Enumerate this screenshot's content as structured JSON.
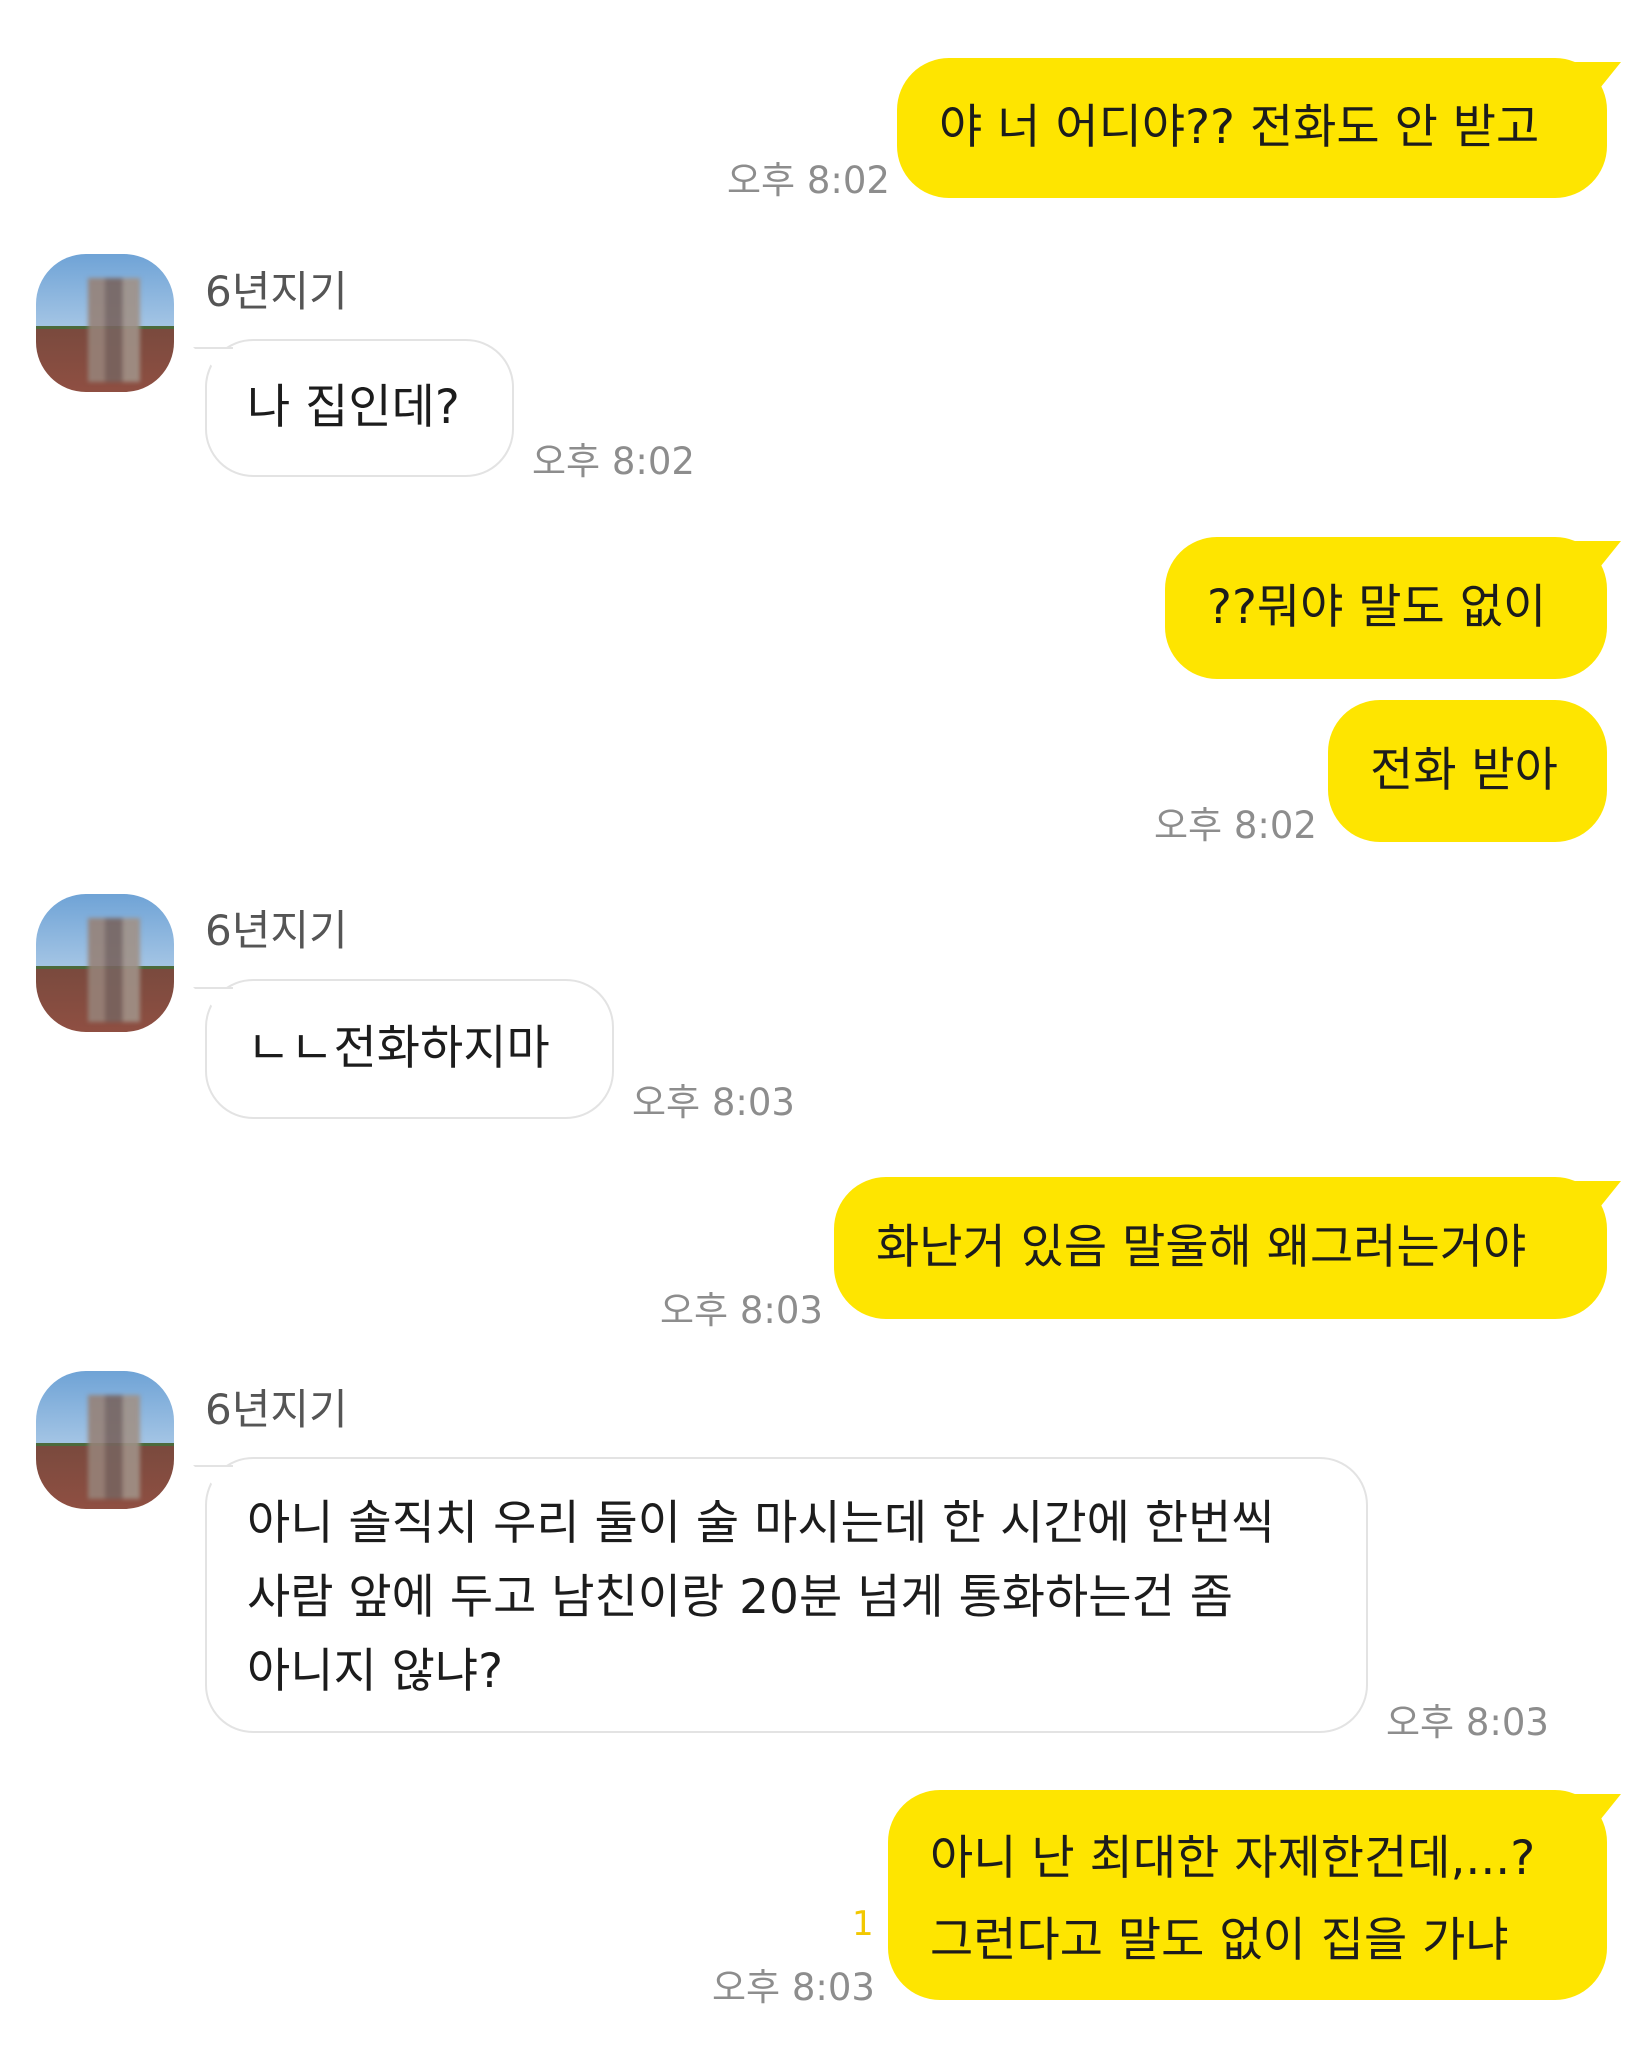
{
  "contact_name": "6년지기",
  "messages": [
    {
      "from": "me",
      "text": "야 너 어디야?? 전화도 안 받고",
      "time": "오후 8:02"
    },
    {
      "from": "them",
      "text": "나 집인데?",
      "time": "오후 8:02"
    },
    {
      "from": "me",
      "text": "??뭐야 말도 없이",
      "time": ""
    },
    {
      "from": "me",
      "text": "전화 받아",
      "time": "오후 8:02"
    },
    {
      "from": "them",
      "text": "ㄴㄴ전화하지마",
      "time": "오후 8:03"
    },
    {
      "from": "me",
      "text": "화난거 있음 말울해 왜그러는거야",
      "time": "오후 8:03"
    },
    {
      "from": "them",
      "lines": [
        "아니 솔직치 우리 둘이 술 마시는데 한 시간에 한번씩",
        "사람 앞에 두고 남친이랑 20분 넘게 통화하는건 좀",
        "아니지 않냐?"
      ],
      "time": "오후 8:03"
    },
    {
      "from": "me",
      "lines": [
        "아니 난 최대한 자제한건데,...?",
        "그런다고 말도 없이 집을 가냐"
      ],
      "time": "오후 8:03",
      "unread": "1"
    }
  ],
  "colors": {
    "my_bubble": "#fee500",
    "their_bubble": "#ffffff",
    "time_text": "#8d8d8d",
    "unread": "#f2c800"
  }
}
